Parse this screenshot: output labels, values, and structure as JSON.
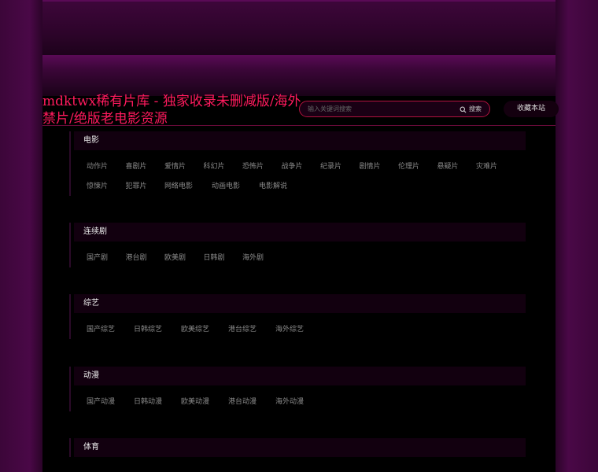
{
  "site": {
    "title": "mdktwx稀有片库 - 独家收录未删减版/海外禁片/绝版老电影资源"
  },
  "search": {
    "placeholder": "输入关键词搜索",
    "button_label": "搜索"
  },
  "favorite": {
    "label": "收藏本站"
  },
  "categories": [
    {
      "name": "电影",
      "items": [
        "动作片",
        "喜剧片",
        "爱情片",
        "科幻片",
        "恐怖片",
        "战争片",
        "纪录片",
        "剧情片",
        "伦理片",
        "悬疑片",
        "灾难片",
        "惊悚片",
        "犯罪片",
        "网络电影",
        "动画电影",
        "电影解说"
      ]
    },
    {
      "name": "连续剧",
      "items": [
        "国产剧",
        "港台剧",
        "欧美剧",
        "日韩剧",
        "海外剧"
      ]
    },
    {
      "name": "综艺",
      "items": [
        "国产综艺",
        "日韩综艺",
        "欧美综艺",
        "港台综艺",
        "海外综艺"
      ]
    },
    {
      "name": "动漫",
      "items": [
        "国产动漫",
        "日韩动漫",
        "欧美动漫",
        "港台动漫",
        "海外动漫"
      ]
    },
    {
      "name": "体育",
      "items": []
    }
  ]
}
